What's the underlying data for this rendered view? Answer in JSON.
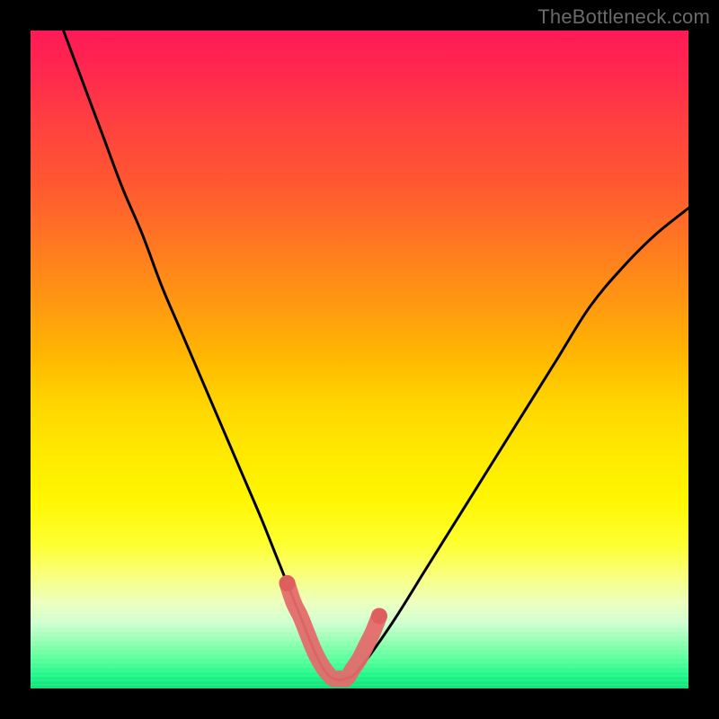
{
  "watermark": {
    "text": "TheBottleneck.com"
  },
  "colors": {
    "curve": "#000000",
    "highlight": "#e46b6b",
    "highlight_cap": "#df5f5f"
  },
  "chart_data": {
    "type": "line",
    "title": "",
    "xlabel": "",
    "ylabel": "",
    "xlim": [
      0,
      100
    ],
    "ylim": [
      0,
      100
    ],
    "grid": false,
    "legend": false,
    "annotations": [
      "TheBottleneck.com"
    ],
    "series": [
      {
        "name": "bottleneck-curve",
        "x": [
          5,
          8,
          11,
          14,
          17,
          20,
          23,
          26,
          29,
          32,
          35,
          37,
          39,
          41,
          43,
          44.5,
          46,
          48,
          50,
          55,
          60,
          65,
          70,
          75,
          80,
          85,
          90,
          95,
          100
        ],
        "y": [
          100,
          92,
          84,
          76,
          69,
          61,
          54,
          47,
          40,
          33,
          26,
          21,
          16,
          11,
          6,
          3,
          1.5,
          1.5,
          3,
          10,
          18,
          26,
          34,
          42,
          50,
          58,
          64,
          69,
          73
        ]
      },
      {
        "name": "optimal-range-highlight",
        "x": [
          39,
          40,
          41,
          42,
          43,
          44,
          45,
          46,
          47,
          48,
          49,
          50,
          51,
          52,
          53
        ],
        "y": [
          16,
          13,
          11,
          8.5,
          6,
          4,
          2.5,
          1.5,
          1.5,
          1.5,
          3,
          4.5,
          6.5,
          8.5,
          11
        ]
      }
    ]
  }
}
